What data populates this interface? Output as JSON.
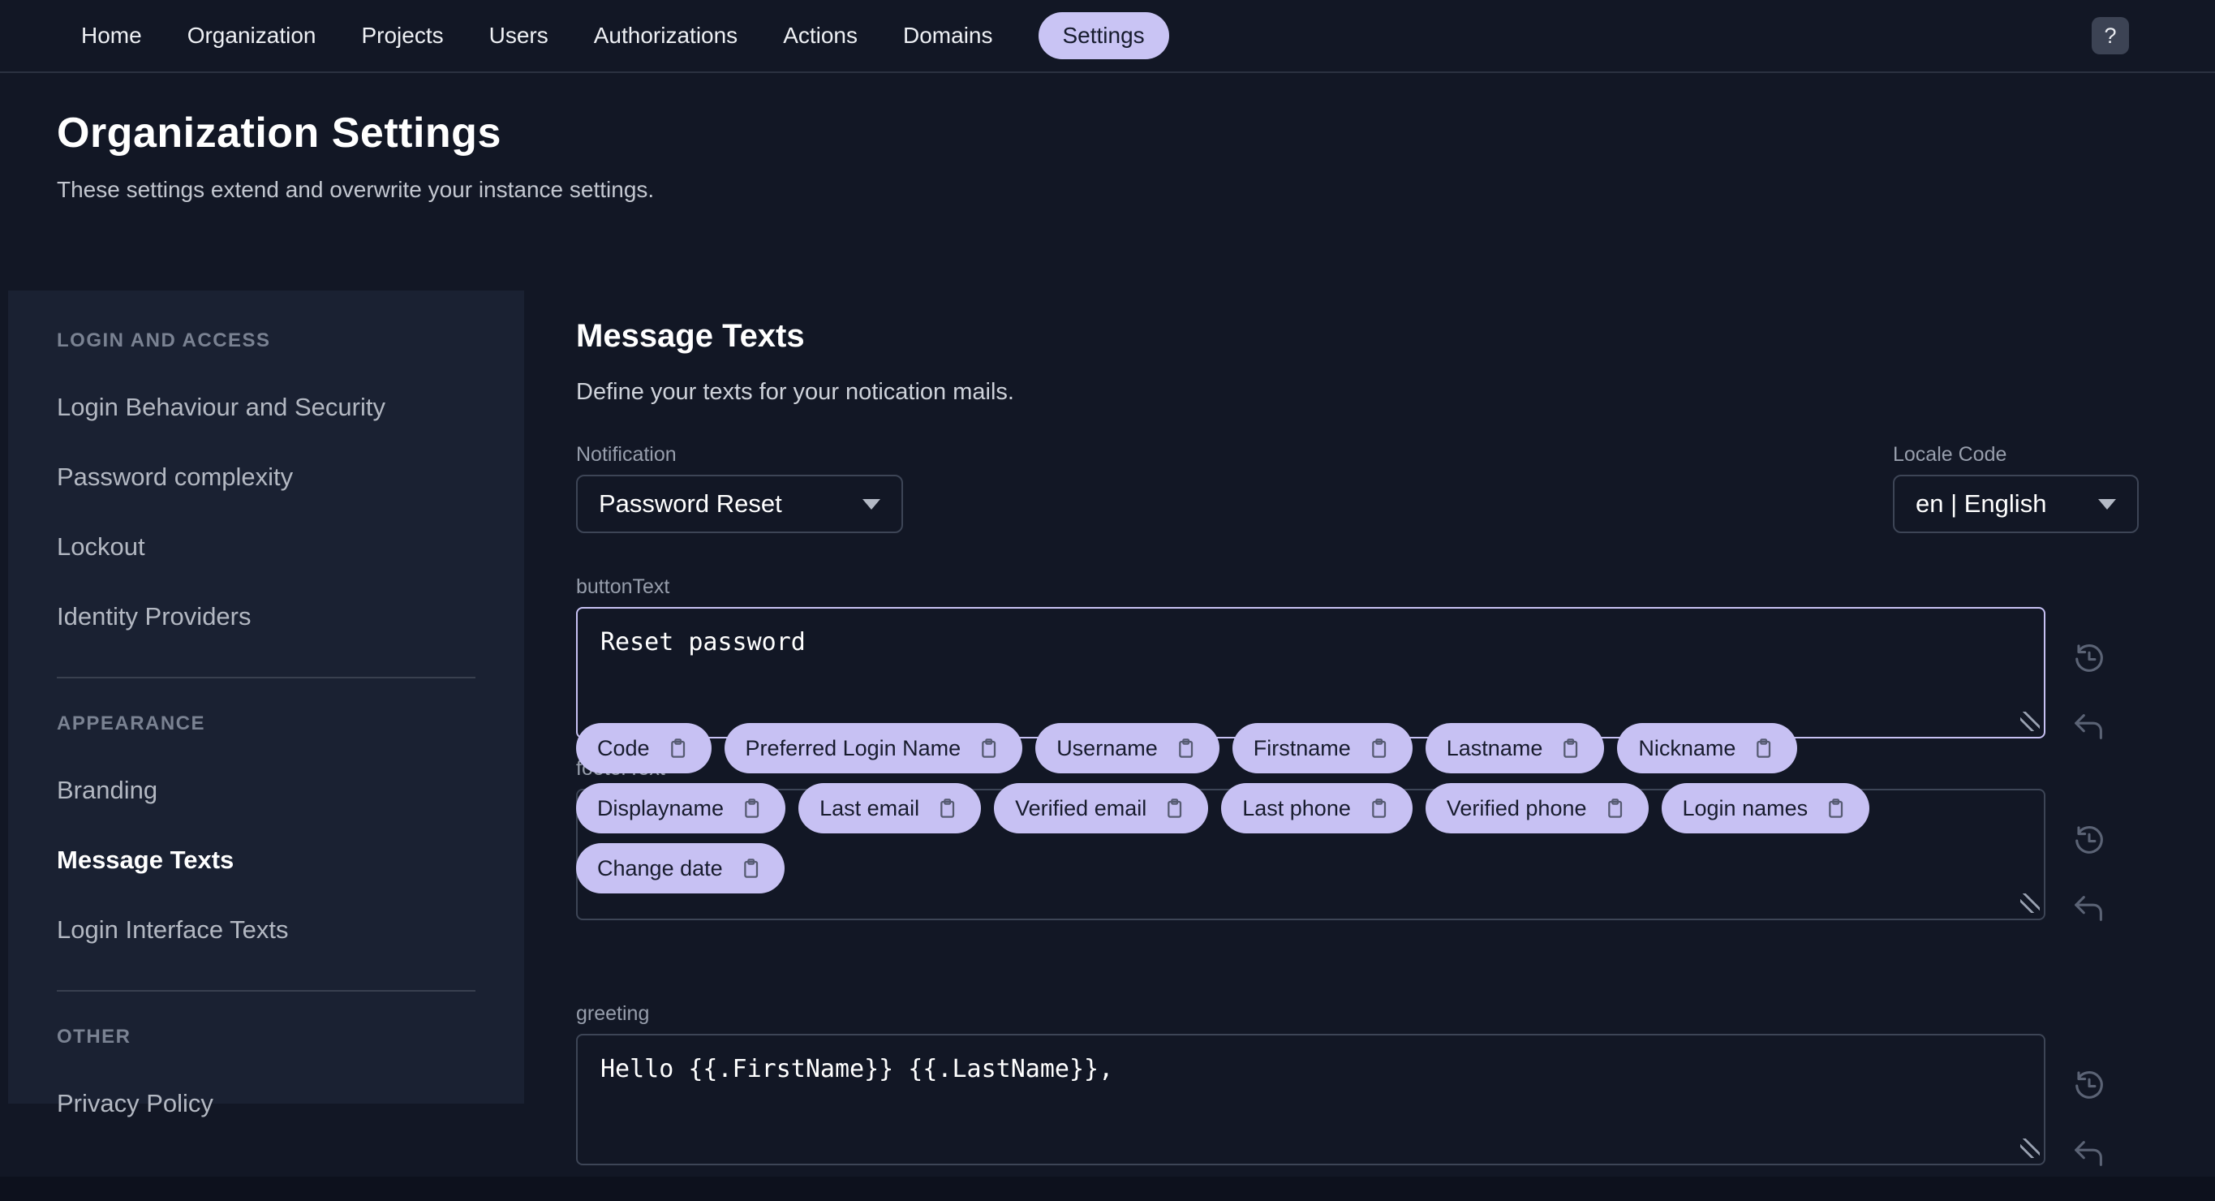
{
  "nav": {
    "items": [
      {
        "label": "Home"
      },
      {
        "label": "Organization"
      },
      {
        "label": "Projects"
      },
      {
        "label": "Users"
      },
      {
        "label": "Authorizations"
      },
      {
        "label": "Actions"
      },
      {
        "label": "Domains"
      },
      {
        "label": "Settings"
      }
    ],
    "active_item": "Settings",
    "help_label": "?"
  },
  "page": {
    "title": "Organization Settings",
    "subtitle": "These settings extend and overwrite your instance settings."
  },
  "sidebar": {
    "sections": [
      {
        "title": "LOGIN AND ACCESS",
        "items": [
          {
            "label": "Login Behaviour and Security"
          },
          {
            "label": "Password complexity"
          },
          {
            "label": "Lockout"
          },
          {
            "label": "Identity Providers"
          }
        ]
      },
      {
        "title": "APPEARANCE",
        "items": [
          {
            "label": "Branding"
          },
          {
            "label": "Message Texts"
          },
          {
            "label": "Login Interface Texts"
          }
        ]
      },
      {
        "title": "OTHER",
        "items": [
          {
            "label": "Privacy Policy"
          }
        ]
      }
    ],
    "active_item": "Message Texts"
  },
  "main": {
    "heading": "Message Texts",
    "description": "Define your texts for your notication mails.",
    "notification": {
      "label": "Notification",
      "value": "Password Reset"
    },
    "locale": {
      "label": "Locale Code",
      "value": "en | English"
    },
    "fields": {
      "button_text": {
        "label": "buttonText",
        "value": "Reset password"
      },
      "footer_text": {
        "label": "footerText",
        "value": ""
      },
      "greeting": {
        "label": "greeting",
        "value": "Hello {{.FirstName}} {{.LastName}},"
      }
    },
    "chips": [
      "Code",
      "Preferred Login Name",
      "Username",
      "Firstname",
      "Lastname",
      "Nickname",
      "Displayname",
      "Last email",
      "Verified email",
      "Last phone",
      "Verified phone",
      "Login names",
      "Change date"
    ],
    "icons": {
      "history": "history-icon",
      "undo": "undo-icon",
      "clipboard": "clipboard-icon"
    }
  },
  "colors": {
    "accent": "#c7c1f3",
    "background": "#121725",
    "sidebar_background": "#1a2132",
    "border": "#3d4556",
    "label": "#979eac"
  }
}
